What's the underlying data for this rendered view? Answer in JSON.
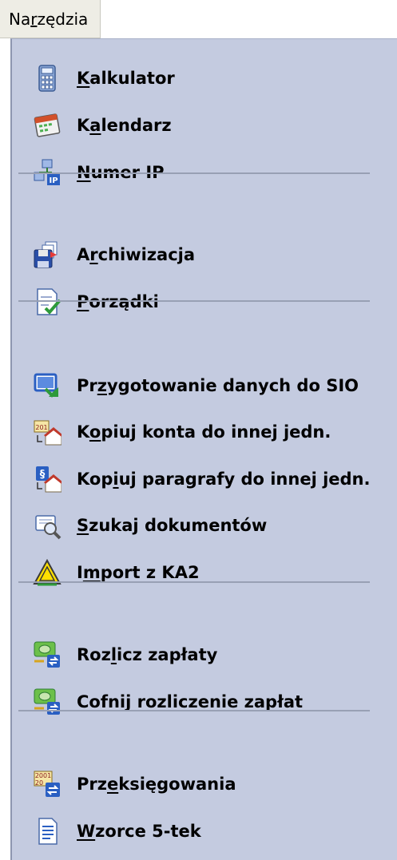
{
  "menubar": {
    "title": "Narzędzia",
    "title_mnemonic_index": 2
  },
  "menu": {
    "items": [
      {
        "name": "kalkulator",
        "label": "Kalkulator",
        "mnemonic": 0,
        "icon": "calculator-icon"
      },
      {
        "name": "kalendarz",
        "label": "Kalendarz",
        "mnemonic": 1,
        "icon": "calendar-icon"
      },
      {
        "name": "numer-ip",
        "label": "Numer IP",
        "mnemonic": 0,
        "icon": "network-ip-icon"
      },
      {
        "separator": true
      },
      {
        "name": "archiwizacja",
        "label": "Archiwizacja",
        "mnemonic": 1,
        "icon": "floppy-archive-icon"
      },
      {
        "name": "porzadki",
        "label": "Porządki",
        "mnemonic": 0,
        "icon": "document-check-icon"
      },
      {
        "separator": true
      },
      {
        "name": "przygotowanie-sio",
        "label": "Przygotowanie danych do SIO",
        "mnemonic": 2,
        "icon": "monitor-export-icon"
      },
      {
        "name": "kopiuj-konta",
        "label": "Kopiuj konta do innej jedn.",
        "mnemonic": 1,
        "icon": "copy-accounts-icon"
      },
      {
        "name": "kopiuj-paragrafy",
        "label": "Kopiuj paragrafy do innej jedn.",
        "mnemonic": 3,
        "icon": "copy-paragraphs-icon"
      },
      {
        "name": "szukaj-dokumentow",
        "label": "Szukaj dokumentów",
        "mnemonic": 0,
        "icon": "search-documents-icon"
      },
      {
        "name": "import-ka2",
        "label": "Import z KA2",
        "mnemonic": 1,
        "icon": "warning-triangle-icon"
      },
      {
        "separator": true
      },
      {
        "name": "rozlicz-zaplaty",
        "label": "Rozlicz zapłaty",
        "mnemonic": 3,
        "icon": "settle-payments-icon"
      },
      {
        "name": "cofnij-rozliczenie",
        "label": "Cofnij rozliczenie zapłat",
        "mnemonic": 0,
        "icon": "undo-settlement-icon"
      },
      {
        "separator": true
      },
      {
        "name": "przeksiegowania",
        "label": "Przeksięgowania",
        "mnemonic": 3,
        "icon": "rebooking-icon"
      },
      {
        "name": "wzorce-5-tek",
        "label": "Wzorce 5-tek",
        "mnemonic": 0,
        "icon": "template-document-icon"
      }
    ]
  },
  "colors": {
    "menu_background": "#c4cbe0",
    "separator": "#98a0b4",
    "menubar_background": "#eeede5"
  }
}
